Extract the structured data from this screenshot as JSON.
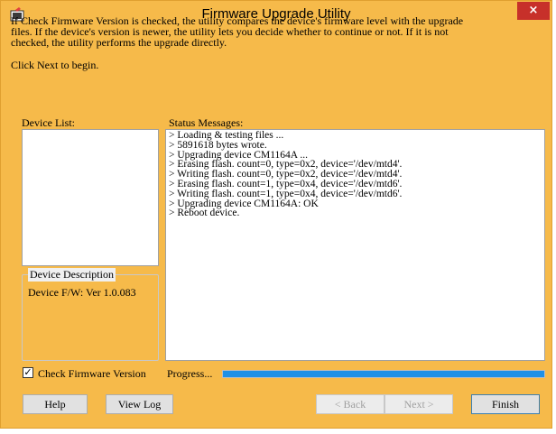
{
  "window": {
    "title": "Firmware Upgrade Utility",
    "close_glyph": "×"
  },
  "info": {
    "line1": "If Check Firmware Version is checked, the utility compares the device's firmware level with the upgrade",
    "line2": "files. If the device's version is newer, the utility lets you decide whether to continue or not. If it is not",
    "line3": "checked, the utility performs the upgrade directly.",
    "start": "Click Next to begin."
  },
  "device_list": {
    "label": "Device List:",
    "items": []
  },
  "device_description": {
    "label": "Device Description",
    "value": "Device F/W: Ver 1.0.083"
  },
  "status": {
    "label": "Status Messages:",
    "lines": [
      "> Loading & testing files ...",
      "> 5891618 bytes wrote.",
      "> Upgrading device CM1164A ...",
      "> Erasing flash. count=0, type=0x2, device='/dev/mtd4'.",
      "> Writing flash. count=0, type=0x2, device='/dev/mtd4'.",
      "> Erasing flash. count=1, type=0x4, device='/dev/mtd6'.",
      "> Writing flash. count=1, type=0x4, device='/dev/mtd6'.",
      "> Upgrading device CM1164A: OK",
      "> Reboot device."
    ]
  },
  "options": {
    "check_firmware_label": "Check Firmware Version",
    "check_firmware_checked": true,
    "check_glyph": "✓"
  },
  "progress": {
    "label": "Progress...",
    "fraction": 1.0
  },
  "buttons": {
    "help": "Help",
    "view_log": "View Log",
    "back": "< Back",
    "next": "Next >",
    "finish": "Finish"
  },
  "colors": {
    "frame": "#f6ba4a",
    "close": "#c7302a",
    "progress": "#1e90e6"
  }
}
